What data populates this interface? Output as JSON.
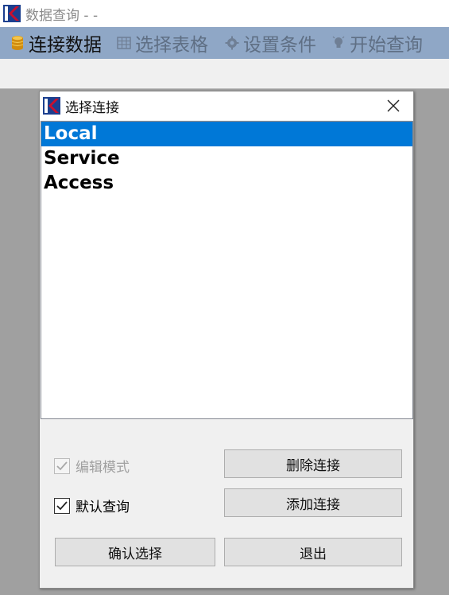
{
  "app": {
    "title": "数据查询 - -",
    "brand_color": "#c8102e",
    "menubar_color": "#8fa7c6"
  },
  "menu": {
    "items": [
      {
        "label": "连接数据",
        "icon": "database-icon",
        "active": true
      },
      {
        "label": "选择表格",
        "icon": "table-icon",
        "active": false
      },
      {
        "label": "设置条件",
        "icon": "gear-icon",
        "active": false
      },
      {
        "label": "开始查询",
        "icon": "lightbulb-icon",
        "active": false
      }
    ]
  },
  "dialog": {
    "title": "选择连接",
    "connections": [
      {
        "label": "Local",
        "selected": true
      },
      {
        "label": "Service",
        "selected": false
      },
      {
        "label": "Access",
        "selected": false
      }
    ],
    "edit_mode": {
      "label": "编辑模式",
      "checked": true,
      "enabled": false
    },
    "default_query": {
      "label": "默认查询",
      "checked": true,
      "enabled": true
    },
    "buttons": {
      "delete": "删除连接",
      "add": "添加连接",
      "confirm": "确认选择",
      "exit": "退出"
    },
    "selection_color": "#0078d7"
  }
}
